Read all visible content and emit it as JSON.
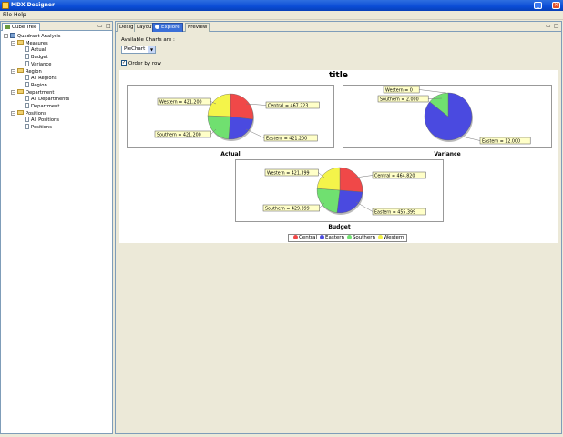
{
  "app": {
    "title": "MDX Designer"
  },
  "menu": [
    "File",
    "Help"
  ],
  "left_panel": {
    "tab_label": "Cube Tree",
    "tree": [
      {
        "label": "Quadrant Analysis",
        "depth": 0,
        "kind": "cube"
      },
      {
        "label": "Measures",
        "depth": 1,
        "kind": "folder"
      },
      {
        "label": "Actual",
        "depth": 2,
        "kind": "leaf"
      },
      {
        "label": "Budget",
        "depth": 2,
        "kind": "leaf"
      },
      {
        "label": "Variance",
        "depth": 2,
        "kind": "leaf"
      },
      {
        "label": "Region",
        "depth": 1,
        "kind": "folder"
      },
      {
        "label": "All Regions",
        "depth": 2,
        "kind": "leaf"
      },
      {
        "label": "Region",
        "depth": 2,
        "kind": "leaf"
      },
      {
        "label": "Department",
        "depth": 1,
        "kind": "folder"
      },
      {
        "label": "All Departments",
        "depth": 2,
        "kind": "leaf"
      },
      {
        "label": "Department",
        "depth": 2,
        "kind": "leaf"
      },
      {
        "label": "Positions",
        "depth": 1,
        "kind": "folder"
      },
      {
        "label": "All Positions",
        "depth": 2,
        "kind": "leaf"
      },
      {
        "label": "Positions",
        "depth": 2,
        "kind": "leaf"
      }
    ]
  },
  "right_panel": {
    "tabs": [
      {
        "label": "Design",
        "active": false
      },
      {
        "label": "Layout",
        "active": false
      },
      {
        "label": "Explore",
        "active": true
      },
      {
        "label": "Preview",
        "active": false
      }
    ],
    "charts_label": "Available Charts are :",
    "chart_select_value": "PieChart",
    "order_by_row_label": "Order by row",
    "order_by_row_checked": true
  },
  "colors": {
    "Central": "#f04848",
    "Eastern": "#4a4ae0",
    "Southern": "#70e070",
    "Western": "#f4f44a"
  },
  "chart_data": {
    "type": "pie",
    "title": "title",
    "categories": [
      "Central",
      "Eastern",
      "Southern",
      "Western"
    ],
    "charts": [
      {
        "name": "Actual",
        "values": [
          467.223,
          421.2,
          421.2,
          421.2
        ],
        "labels": [
          "Central = 467.223",
          "Eastern = 421.200",
          "Southern = 421.200",
          "Western = 421.200"
        ]
      },
      {
        "name": "Variance",
        "values": [
          0,
          12.0,
          2.0,
          0
        ],
        "labels": [
          "",
          "Eastern = 12.000",
          "Southern = 2.000",
          "Western = 0"
        ]
      },
      {
        "name": "Budget",
        "values": [
          464.82,
          455.399,
          429.399,
          421.399
        ],
        "labels": [
          "Central = 464.820",
          "Eastern = 455.399",
          "Southern = 429.399",
          "Western = 421.399"
        ]
      }
    ],
    "legend": [
      "Central",
      "Eastern",
      "Southern",
      "Western"
    ],
    "legend_position": "bottom"
  }
}
